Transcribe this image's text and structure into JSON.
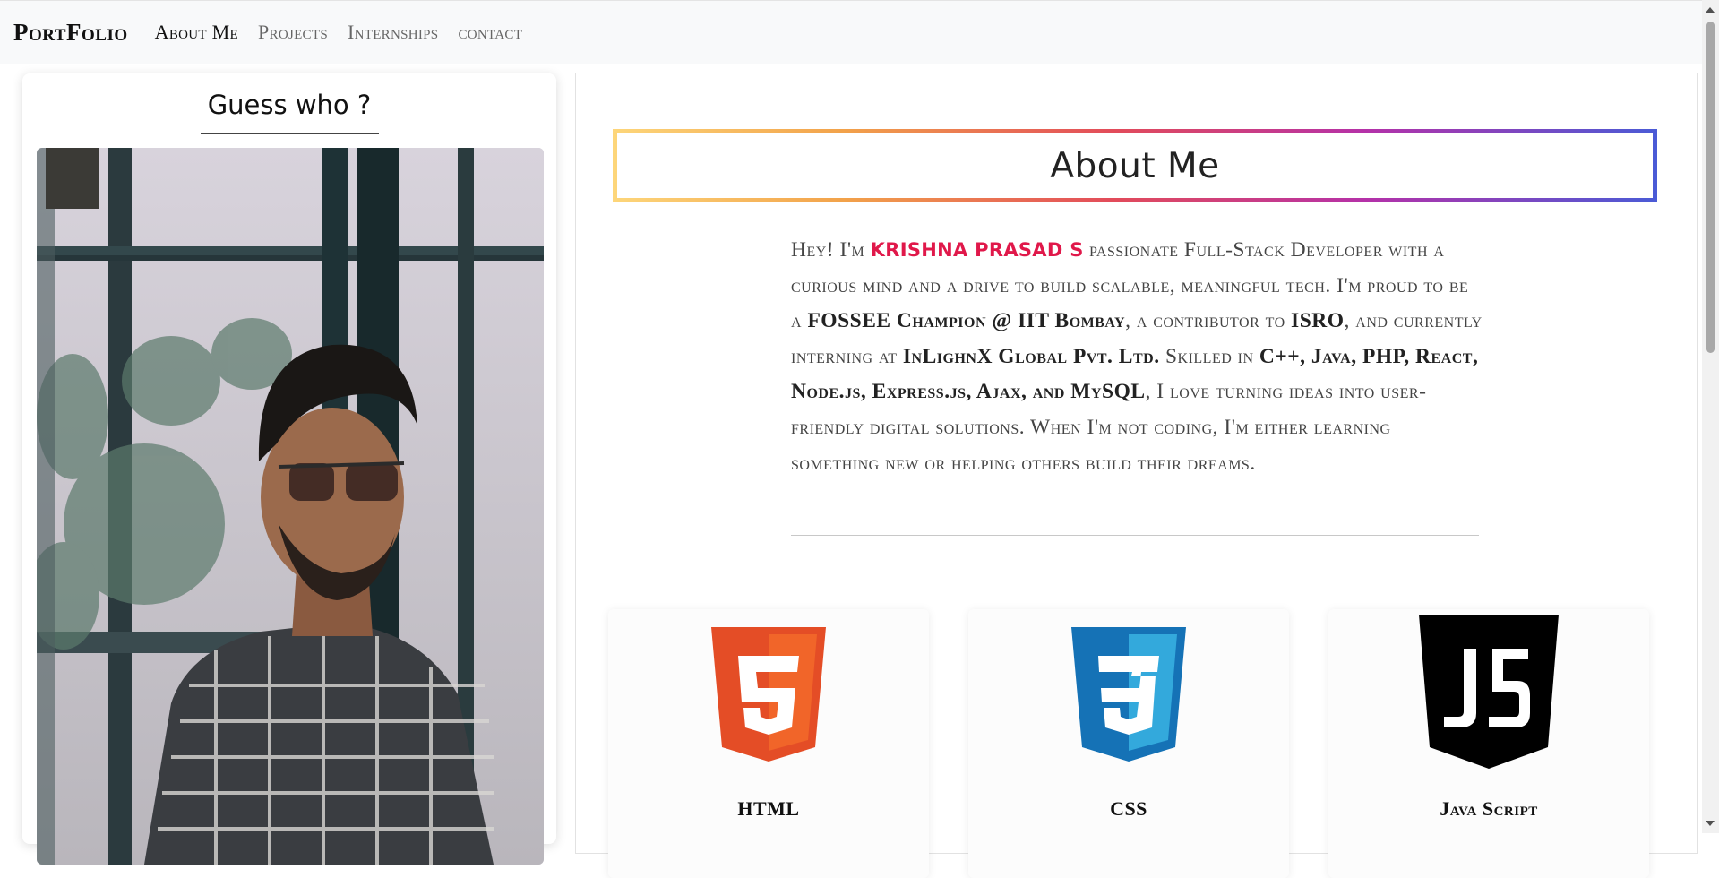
{
  "navbar": {
    "brand": "PortFolio",
    "links": [
      "About Me",
      "Projects",
      "Internships",
      "contact"
    ],
    "active_index": 0
  },
  "profile": {
    "title": "Guess who ?",
    "photo_alt": "profile-photo"
  },
  "about": {
    "heading": "About Me",
    "bio": {
      "t1": "Hey! I'm ",
      "name": "KRISHNA PRASAD S",
      "t2": " passionate Full-Stack Developer with a curious mind and a drive to build scalable, meaningful tech. I'm proud to be a ",
      "b1": "FOSSEE Champion @ IIT Bombay",
      "t3": ", a contributor to ",
      "b2": "ISRO",
      "t4": ", and currently interning at ",
      "b3": "InLighnX Global Pvt. Ltd.",
      "t5": " Skilled in ",
      "b4": "C++, Java, PHP, React, Node.js, Express.js, Ajax, and MySQL",
      "t6": ", I love turning ideas into user-friendly digital solutions. When I'm not coding, I'm either learning something new or helping others build their dreams."
    },
    "skills": [
      {
        "label": "HTML",
        "icon": "html5-icon",
        "color": "#e44d26"
      },
      {
        "label": "CSS",
        "icon": "css3-icon",
        "color": "#1572b6"
      },
      {
        "label": "Java Script",
        "icon": "js-icon",
        "color": "#000000"
      }
    ]
  },
  "colors": {
    "name_highlight": "#e0184a",
    "gradient": [
      "#fdd67a",
      "#f2a24a",
      "#e24b5a",
      "#b531a8",
      "#4a5bd6"
    ]
  }
}
